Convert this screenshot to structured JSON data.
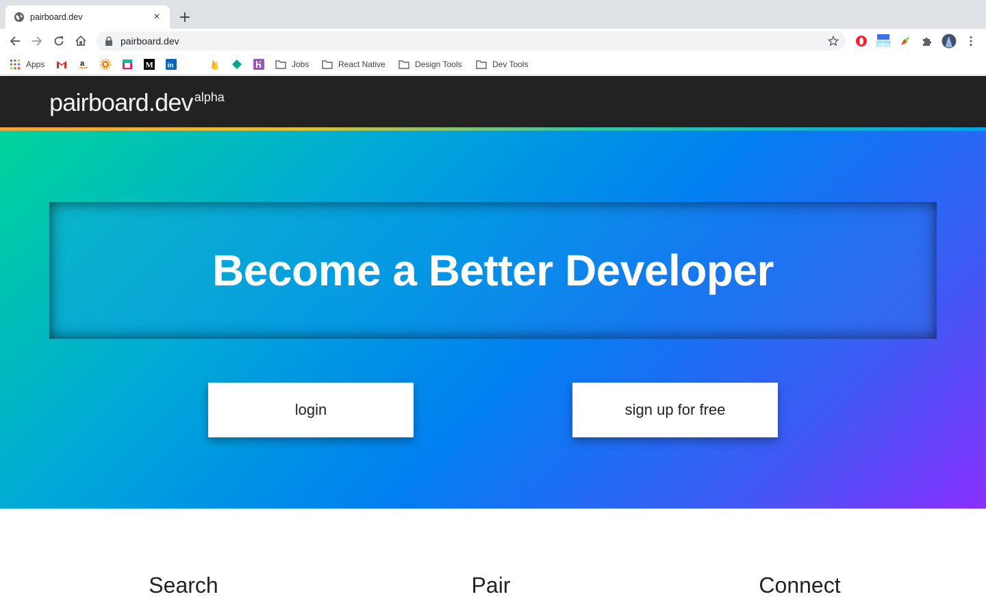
{
  "browser": {
    "tab": {
      "title": "pairboard.dev",
      "favicon": "globe-icon",
      "close": "×"
    },
    "new_tab": "+",
    "omnibox": {
      "url": "pairboard.dev",
      "lock": "lock-icon"
    },
    "extensions": {
      "timer_badge": "28m"
    }
  },
  "bookmarks": {
    "apps_label": "Apps",
    "folders": [
      {
        "label": "Jobs"
      },
      {
        "label": "React Native"
      },
      {
        "label": "Design Tools"
      },
      {
        "label": "Dev Tools"
      }
    ]
  },
  "site": {
    "brand": {
      "name": "pairboard.dev",
      "badge": "alpha"
    },
    "hero": {
      "title": "Become a Better Developer"
    },
    "buttons": {
      "login": "login",
      "signup": "sign up for free"
    },
    "features": [
      {
        "title": "Search"
      },
      {
        "title": "Pair"
      },
      {
        "title": "Connect"
      }
    ]
  },
  "colors": {
    "header_bg": "#222222",
    "hero_gradient_start": "#00d49a",
    "hero_gradient_end": "#8a30ff"
  }
}
